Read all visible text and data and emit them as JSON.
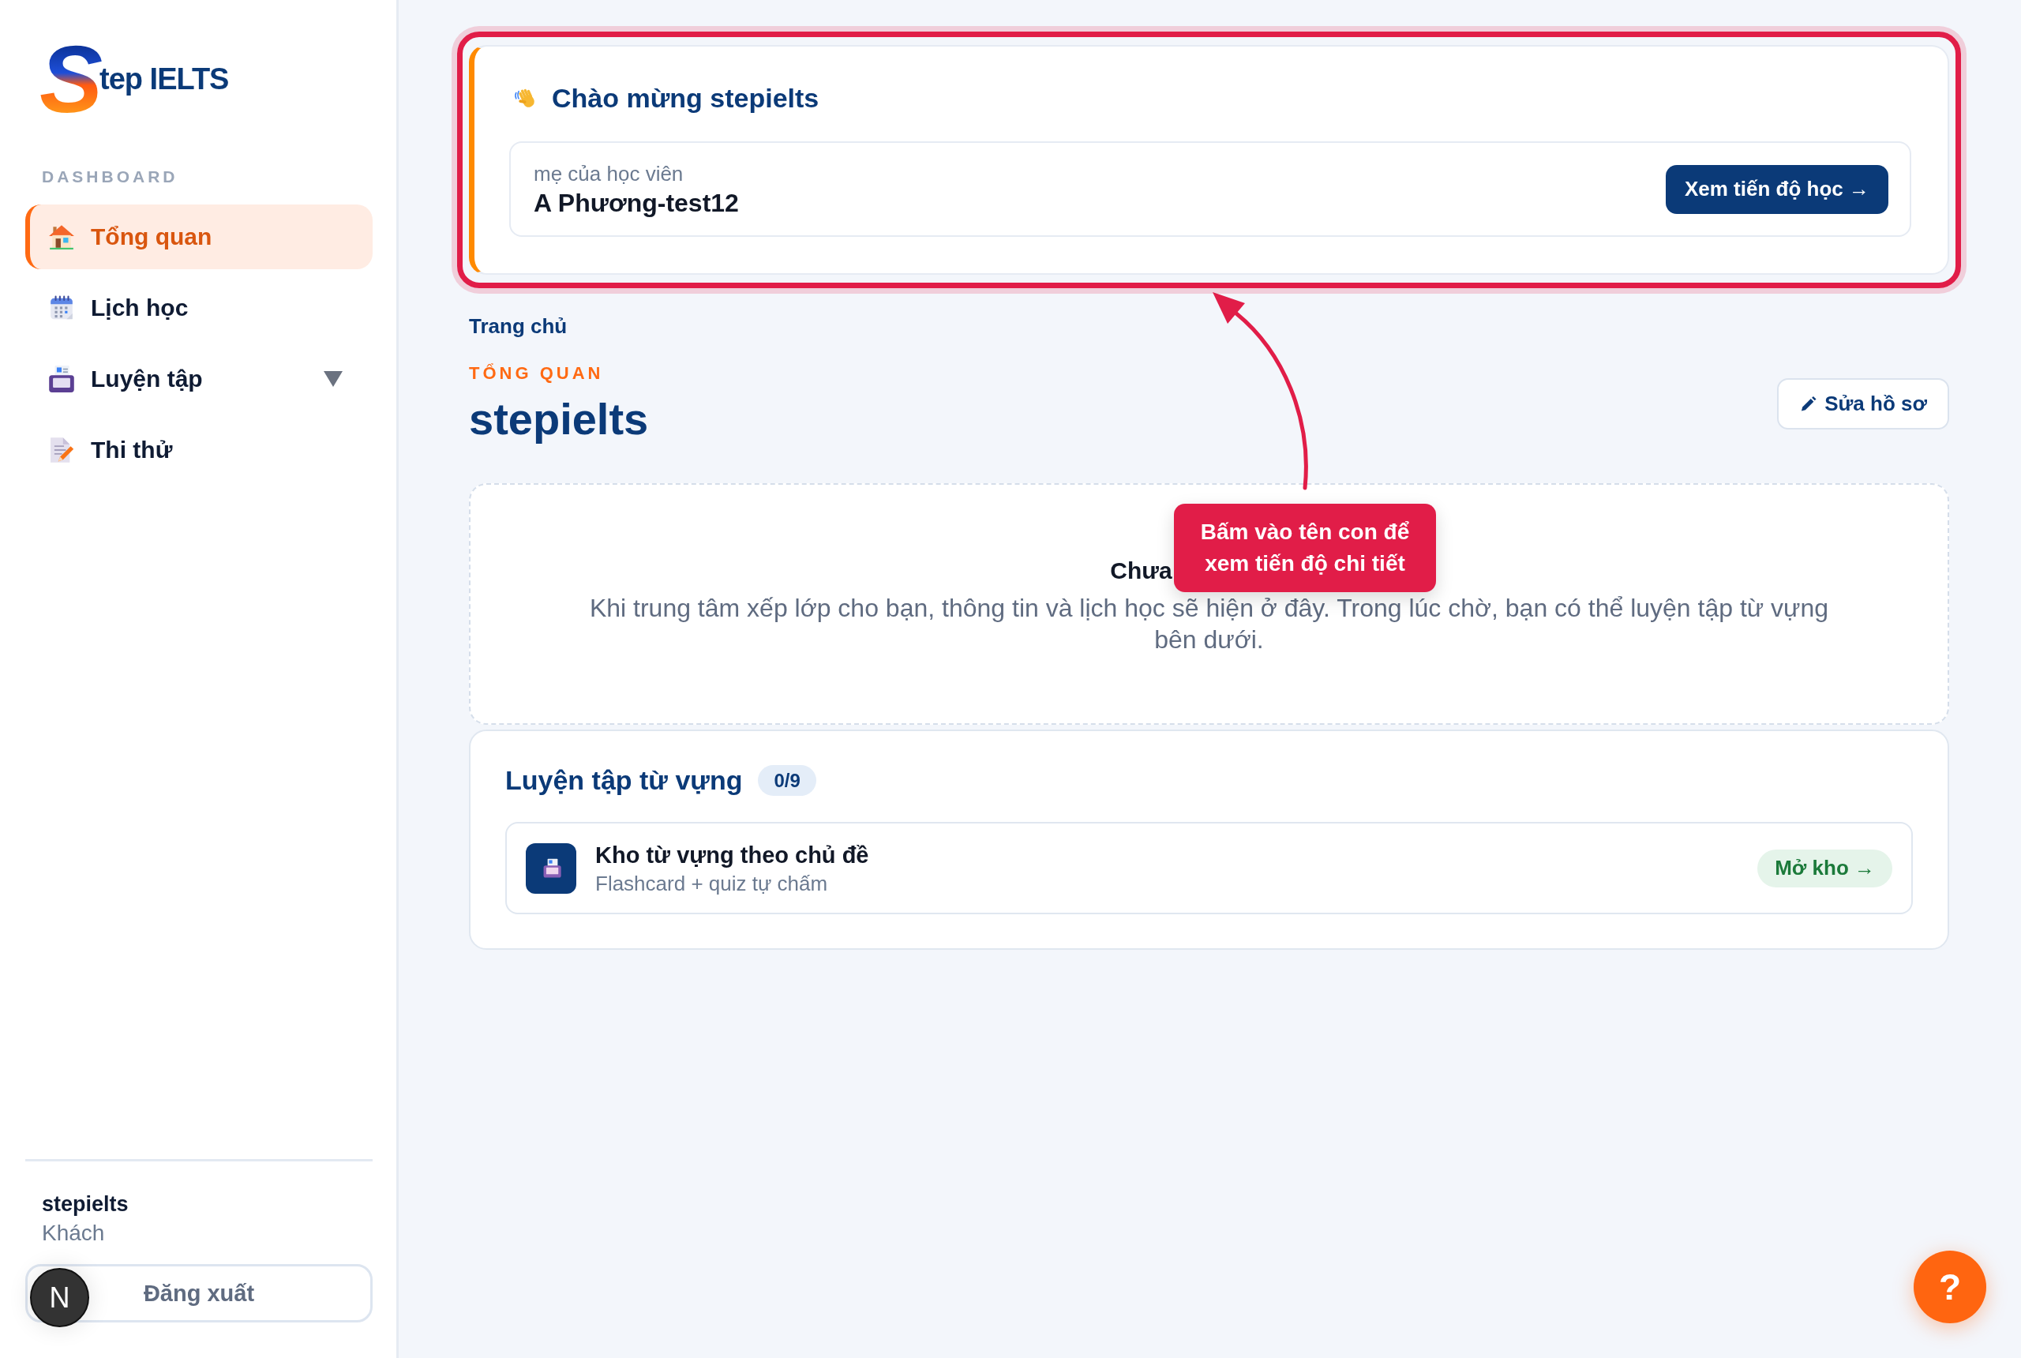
{
  "sidebar": {
    "logo": {
      "initial": "S",
      "rest": "tep IELTS"
    },
    "section_label": "DASHBOARD",
    "items": [
      {
        "label": "Tổng quan",
        "kind": "link",
        "selected": true
      },
      {
        "label": "Lịch học",
        "kind": "link",
        "selected": false
      },
      {
        "label": "Luyện tập",
        "kind": "group",
        "selected": false
      },
      {
        "label": "Thi thử",
        "kind": "link",
        "selected": false
      }
    ],
    "user": {
      "name": "stepielts",
      "role": "Khách"
    },
    "logout_button": "Đăng xuất"
  },
  "welcome_card": {
    "title": "Chào mừng stepielts",
    "student": {
      "relation": "mẹ của học viên",
      "name": "A Phương-test12"
    },
    "button": "Xem tiến độ học →"
  },
  "breadcrumb": "Trang chủ",
  "page_header": {
    "eyebrow": "TỔNG QUAN",
    "title": "stepielts",
    "edit_button": "Sửa hồ sơ"
  },
  "empty_state": {
    "title": "Chưa",
    "description": "Khi trung tâm xếp lớp cho bạn, thông tin và lịch học sẽ hiện ở đây. Trong lúc chờ, bạn có thể luyện tập từ vựng bên dưới."
  },
  "vocab_section": {
    "title": "Luyện tập từ vựng",
    "progress": "0/9",
    "items": [
      {
        "title": "Kho từ vựng theo chủ đề",
        "subtitle": "Flashcard + quiz tự chấm",
        "button": "Mở kho →"
      }
    ]
  },
  "tour": {
    "tooltip": "Bấm vào tên con để xem tiến độ chi tiết"
  },
  "help_button": "?",
  "dev_indicator": {
    "label": "N"
  }
}
